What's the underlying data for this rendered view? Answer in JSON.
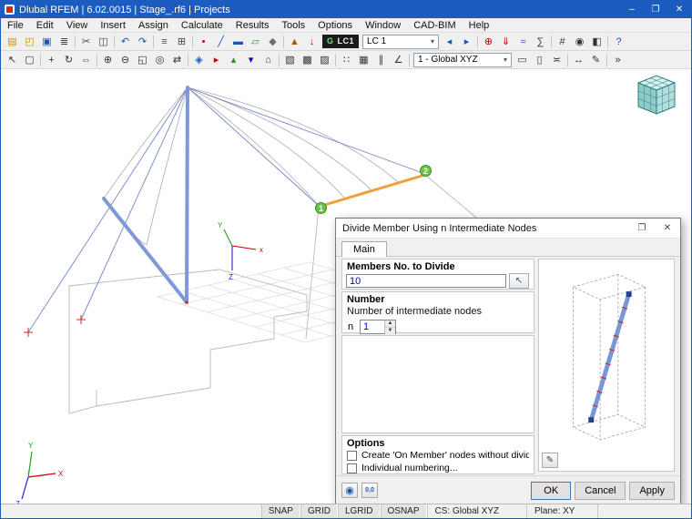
{
  "window": {
    "title": "Dlubal RFEM | 6.02.0015 | Stage_.rf6 | Projects",
    "minimize": "–",
    "maximize": "❐",
    "close": "✕"
  },
  "menubar": {
    "items": [
      "File",
      "Edit",
      "View",
      "Insert",
      "Assign",
      "Calculate",
      "Results",
      "Tools",
      "Options",
      "Window",
      "CAD-BIM",
      "Help"
    ]
  },
  "toolbar1": {
    "group1": [
      {
        "name": "new-model-icon",
        "glyph": "▤",
        "color": "#c89000"
      },
      {
        "name": "open-model-icon",
        "glyph": "◰",
        "color": "#c89000"
      },
      {
        "name": "save-icon",
        "glyph": "▣",
        "color": "#1a56b0"
      },
      {
        "name": "print-icon",
        "glyph": "≣",
        "color": "#444444"
      },
      {
        "sep": true
      },
      {
        "name": "cut-icon",
        "glyph": "✂",
        "color": "#444444"
      },
      {
        "name": "copy-icon",
        "glyph": "◫",
        "color": "#444444"
      },
      {
        "sep": true
      },
      {
        "name": "undo-icon",
        "glyph": "↶",
        "color": "#1a56b0"
      },
      {
        "name": "redo-icon",
        "glyph": "↷",
        "color": "#1a56b0"
      },
      {
        "sep": true
      },
      {
        "name": "project-navigator-icon",
        "glyph": "≡",
        "color": "#444444"
      },
      {
        "name": "tables-icon",
        "glyph": "⊞",
        "color": "#444444"
      },
      {
        "sep": true
      },
      {
        "name": "node-icon",
        "glyph": "•",
        "color": "#c00000"
      },
      {
        "name": "line-icon",
        "glyph": "╱",
        "color": "#1a56b0"
      },
      {
        "name": "member-icon",
        "glyph": "▬",
        "color": "#1a56b0"
      },
      {
        "name": "surface-icon",
        "glyph": "▱",
        "color": "#2e8b2e"
      },
      {
        "name": "solid-icon",
        "glyph": "◆",
        "color": "#707070"
      },
      {
        "sep": true
      },
      {
        "name": "support-icon",
        "glyph": "▲",
        "color": "#996600"
      },
      {
        "name": "load-icon",
        "glyph": "↓",
        "color": "#c00000"
      }
    ],
    "lcd": {
      "left": "G",
      "right": "LC1"
    },
    "lc_combo": {
      "value": "LC 1",
      "arrow": "▾"
    },
    "group2": [
      {
        "name": "previous-load-case-icon",
        "glyph": "◂",
        "color": "#1a56b0"
      },
      {
        "name": "next-load-case-icon",
        "glyph": "▸",
        "color": "#1a56b0"
      },
      {
        "sep": true
      },
      {
        "name": "new-load-case-icon",
        "glyph": "⊕",
        "color": "#c00000"
      },
      {
        "name": "show-loads-icon",
        "glyph": "⇓",
        "color": "#c00000"
      },
      {
        "name": "show-results-icon",
        "glyph": "≈",
        "color": "#1a56b0"
      },
      {
        "name": "calculate-all-icon",
        "glyph": "∑",
        "color": "#333333"
      },
      {
        "sep": true
      },
      {
        "name": "mesh-icon",
        "glyph": "#",
        "color": "#333333"
      },
      {
        "name": "visibility-icon",
        "glyph": "◉",
        "color": "#333333"
      },
      {
        "name": "clipping-plane-icon",
        "glyph": "◧",
        "color": "#333333"
      },
      {
        "sep": true
      },
      {
        "name": "help-icon",
        "glyph": "?",
        "color": "#1a56b0"
      }
    ]
  },
  "toolbar2": {
    "group1": [
      {
        "name": "select-arrow-icon",
        "glyph": "↖",
        "color": "#333333"
      },
      {
        "name": "select-window-icon",
        "glyph": "▢",
        "color": "#333333"
      },
      {
        "sep": true
      },
      {
        "name": "move-copy-icon",
        "glyph": "+",
        "color": "#333333"
      },
      {
        "name": "rotate-icon",
        "glyph": "↻",
        "color": "#333333"
      },
      {
        "name": "mirror-icon",
        "glyph": "⇔",
        "color": "#333333"
      },
      {
        "sep": true
      },
      {
        "name": "zoom-in-icon",
        "glyph": "⊕",
        "color": "#333333"
      },
      {
        "name": "zoom-out-icon",
        "glyph": "⊖",
        "color": "#333333"
      },
      {
        "name": "zoom-window-icon",
        "glyph": "◱",
        "color": "#333333"
      },
      {
        "name": "zoom-all-icon",
        "glyph": "◎",
        "color": "#333333"
      },
      {
        "name": "pan-icon",
        "glyph": "⇄",
        "color": "#333333"
      },
      {
        "sep": true
      },
      {
        "name": "isometric-view-icon",
        "glyph": "◈",
        "color": "#1a56b0"
      },
      {
        "name": "view-x-icon",
        "glyph": "▸",
        "color": "#c00000"
      },
      {
        "name": "view-y-icon",
        "glyph": "▴",
        "color": "#2e8b2e"
      },
      {
        "name": "view-z-icon",
        "glyph": "▾",
        "color": "#0000c0"
      },
      {
        "name": "perspective-view-icon",
        "glyph": "⌂",
        "color": "#333333"
      },
      {
        "sep": true
      },
      {
        "name": "wireframe-display-icon",
        "glyph": "▧",
        "color": "#333333"
      },
      {
        "name": "shaded-display-icon",
        "glyph": "▩",
        "color": "#333333"
      },
      {
        "name": "transparent-display-icon",
        "glyph": "▨",
        "color": "#333333"
      },
      {
        "sep": true
      },
      {
        "name": "snap-toggle-icon",
        "glyph": "∷",
        "color": "#333333"
      },
      {
        "name": "grid-toggle-icon",
        "glyph": "▦",
        "color": "#333333"
      },
      {
        "name": "guidelines-icon",
        "glyph": "∥",
        "color": "#333333"
      },
      {
        "name": "angle-snap-icon",
        "glyph": "∠",
        "color": "#333333"
      },
      {
        "sep": true
      }
    ],
    "cs_combo": {
      "value": "1 - Global XYZ",
      "arrow": "▾"
    },
    "group2": [
      {
        "name": "workplane-xy-icon",
        "glyph": "▭",
        "color": "#333333"
      },
      {
        "name": "workplane-yz-icon",
        "glyph": "▯",
        "color": "#333333"
      },
      {
        "name": "plane-offset-icon",
        "glyph": "≍",
        "color": "#333333"
      },
      {
        "sep": true
      },
      {
        "name": "dimension-icon",
        "glyph": "↔",
        "color": "#333333"
      },
      {
        "name": "comment-icon",
        "glyph": "✎",
        "color": "#333333"
      },
      {
        "sep": true
      },
      {
        "name": "toolbar-overflow-icon",
        "glyph": "»",
        "color": "#333333"
      }
    ]
  },
  "canvas": {
    "node_badge_1": "1",
    "node_badge_2": "2",
    "axis_x": "x",
    "axis_y": "Y",
    "axis_z": "Z",
    "axis2_x": "X",
    "axis2_y": "Y",
    "axis2_z": "Z",
    "member_color": "#8098d8",
    "selected_member_color": "#f0a038",
    "badge_color": "#6cc04a"
  },
  "dialog": {
    "title": "Divide Member Using n Intermediate Nodes",
    "maximize": "❐",
    "close": "✕",
    "tab_main": "Main",
    "members": {
      "header": "Members No. to Divide",
      "value": "10",
      "pick_glyph": "↖"
    },
    "number": {
      "header": "Number",
      "label": "Number of intermediate nodes",
      "n_label": "n",
      "value": "1",
      "up_glyph": "▲",
      "down_glyph": "▼"
    },
    "options": {
      "header": "Options",
      "checkbox1": "Create 'On Member' nodes without dividing member",
      "checkbox2": "Individual numbering..."
    },
    "preview_settings_glyph": "✎",
    "footer": {
      "details_glyph": "◉",
      "units_glyph": "0,0",
      "ok": "OK",
      "cancel": "Cancel",
      "apply": "Apply"
    }
  },
  "statusbar": {
    "toggles": [
      "SNAP",
      "GRID",
      "LGRID",
      "OSNAP"
    ],
    "cs": "CS: Global XYZ",
    "plane": "Plane: XY"
  }
}
